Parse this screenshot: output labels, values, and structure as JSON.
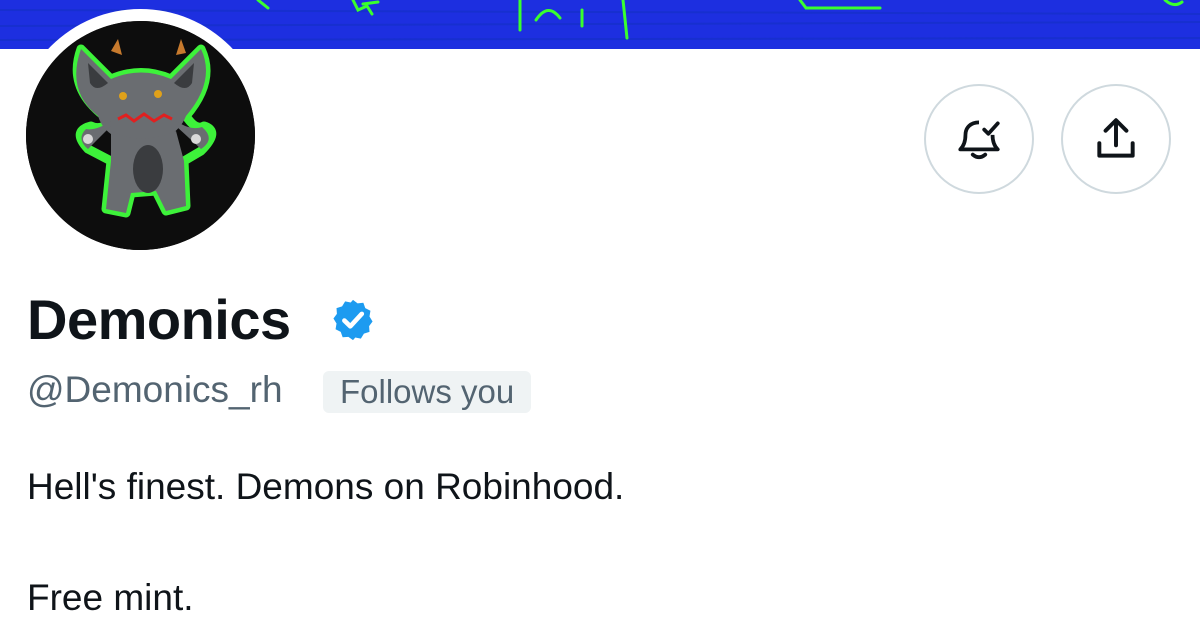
{
  "profile": {
    "display_name": "Demonics",
    "handle": "@Demonics_rh",
    "follows_badge": "Follows you",
    "verified": true,
    "bio_lines": [
      "Hell's finest. Demons on Robinhood.",
      "Free mint."
    ]
  },
  "icons": {
    "verified": "verified-badge-icon",
    "notifications": "bell-check-icon",
    "share": "share-upload-icon"
  },
  "colors": {
    "banner": "#1d2fe0",
    "banner_doodle": "#39ff2e",
    "verified": "#1d9bf0",
    "text_primary": "#0f1419",
    "text_secondary": "#536471",
    "badge_bg": "#eff3f4",
    "button_border": "#cfd9de"
  }
}
